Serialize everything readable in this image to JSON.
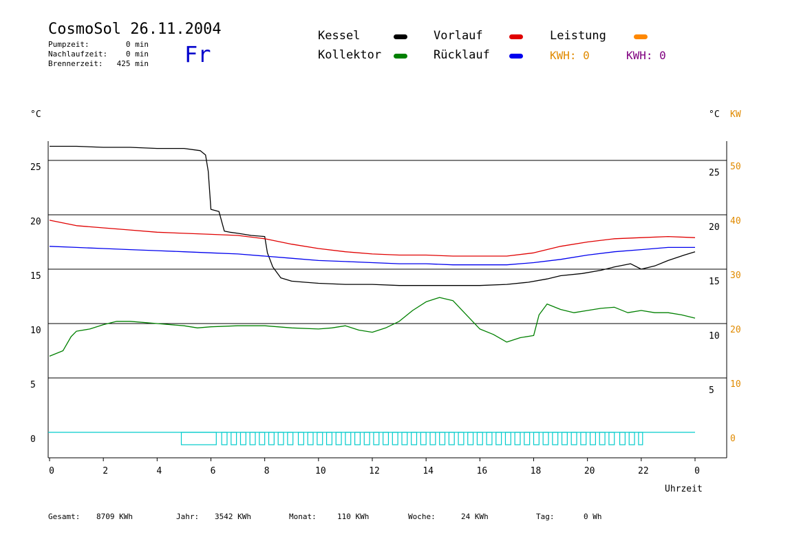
{
  "header": {
    "title": "CosmoSol 26.11.2004",
    "weekday": "Fr",
    "info": [
      {
        "label": "Pumpzeit:",
        "value": "0 min"
      },
      {
        "label": "Nachlaufzeit:",
        "value": "0 min"
      },
      {
        "label": "Brennerzeit:",
        "value": "425 min"
      }
    ]
  },
  "legend": {
    "items": [
      {
        "label": "Kessel",
        "color": "#000000"
      },
      {
        "label": "Kollektor",
        "color": "#008000"
      },
      {
        "label": "Vorlauf",
        "color": "#e00000"
      },
      {
        "label": "Rücklauf",
        "color": "#0000ee"
      },
      {
        "label": "Leistung",
        "color": "#ff8800"
      }
    ],
    "kwh1": "KWH: 0",
    "kwh2": "KWH: 0",
    "kwh1_color": "#e08a00",
    "kwh2_color": "#800080"
  },
  "footer": {
    "gesamt_label": "Gesamt:",
    "gesamt_value": "8709 KWh",
    "jahr_label": "Jahr:",
    "jahr_value": "3542 KWh",
    "monat_label": "Monat:",
    "monat_value": "110 KWh",
    "woche_label": "Woche:",
    "woche_value": "24 KWh",
    "tag_label": "Tag:",
    "tag_value": "0 Wh"
  },
  "chart_data": {
    "type": "line",
    "xlabel": "Uhrzeit",
    "left_unit": "°C",
    "right_unit": "°C",
    "right_unit2": "KW",
    "x_ticks": [
      "0",
      "2",
      "4",
      "6",
      "8",
      "10",
      "12",
      "14",
      "16",
      "18",
      "20",
      "22",
      "0"
    ],
    "y_left_ticks": [
      "0",
      "5",
      "10",
      "15",
      "20",
      "25"
    ],
    "y_right_ticks": [
      "5",
      "10",
      "15",
      "20",
      "25"
    ],
    "y_right2_ticks": [
      "0",
      "10",
      "20",
      "30",
      "40",
      "50"
    ],
    "xlim": [
      0,
      24
    ],
    "ylim": [
      -2,
      27
    ],
    "grid": true,
    "series": [
      {
        "name": "Kessel",
        "color": "#000000",
        "points": [
          [
            0,
            26.3
          ],
          [
            1,
            26.3
          ],
          [
            2,
            26.2
          ],
          [
            3,
            26.2
          ],
          [
            4,
            26.1
          ],
          [
            5,
            26.1
          ],
          [
            5.6,
            25.9
          ],
          [
            5.8,
            25.5
          ],
          [
            5.9,
            24
          ],
          [
            6.0,
            20.5
          ],
          [
            6.3,
            20.3
          ],
          [
            6.5,
            18.5
          ],
          [
            6.7,
            18.4
          ],
          [
            7.0,
            18.3
          ],
          [
            7.5,
            18.1
          ],
          [
            8.0,
            18.0
          ],
          [
            8.1,
            16.5
          ],
          [
            8.3,
            15.2
          ],
          [
            8.6,
            14.2
          ],
          [
            9.0,
            13.9
          ],
          [
            9.5,
            13.8
          ],
          [
            10,
            13.7
          ],
          [
            11,
            13.6
          ],
          [
            12,
            13.6
          ],
          [
            13,
            13.5
          ],
          [
            14,
            13.5
          ],
          [
            15,
            13.5
          ],
          [
            16,
            13.5
          ],
          [
            17,
            13.6
          ],
          [
            17.8,
            13.8
          ],
          [
            18.5,
            14.1
          ],
          [
            19,
            14.4
          ],
          [
            19.8,
            14.6
          ],
          [
            20.5,
            14.9
          ],
          [
            21,
            15.2
          ],
          [
            21.6,
            15.5
          ],
          [
            22,
            15.0
          ],
          [
            22.5,
            15.3
          ],
          [
            23,
            15.8
          ],
          [
            23.6,
            16.3
          ],
          [
            24,
            16.6
          ]
        ]
      },
      {
        "name": "Vorlauf",
        "color": "#e00000",
        "points": [
          [
            0,
            19.5
          ],
          [
            1,
            19.0
          ],
          [
            2,
            18.8
          ],
          [
            3,
            18.6
          ],
          [
            4,
            18.4
          ],
          [
            5,
            18.3
          ],
          [
            6,
            18.2
          ],
          [
            7,
            18.1
          ],
          [
            8,
            17.8
          ],
          [
            9,
            17.3
          ],
          [
            10,
            16.9
          ],
          [
            11,
            16.6
          ],
          [
            12,
            16.4
          ],
          [
            13,
            16.3
          ],
          [
            14,
            16.3
          ],
          [
            15,
            16.2
          ],
          [
            16,
            16.2
          ],
          [
            17,
            16.2
          ],
          [
            18,
            16.5
          ],
          [
            19,
            17.1
          ],
          [
            20,
            17.5
          ],
          [
            21,
            17.8
          ],
          [
            22,
            17.9
          ],
          [
            23,
            18.0
          ],
          [
            24,
            17.9
          ]
        ]
      },
      {
        "name": "Rücklauf",
        "color": "#0000ee",
        "points": [
          [
            0,
            17.1
          ],
          [
            1,
            17.0
          ],
          [
            2,
            16.9
          ],
          [
            3,
            16.8
          ],
          [
            4,
            16.7
          ],
          [
            5,
            16.6
          ],
          [
            6,
            16.5
          ],
          [
            7,
            16.4
          ],
          [
            8,
            16.2
          ],
          [
            9,
            16.0
          ],
          [
            10,
            15.8
          ],
          [
            11,
            15.7
          ],
          [
            12,
            15.6
          ],
          [
            13,
            15.5
          ],
          [
            14,
            15.5
          ],
          [
            15,
            15.4
          ],
          [
            16,
            15.4
          ],
          [
            17,
            15.4
          ],
          [
            18,
            15.6
          ],
          [
            19,
            15.9
          ],
          [
            20,
            16.3
          ],
          [
            21,
            16.6
          ],
          [
            22,
            16.8
          ],
          [
            23,
            17.0
          ],
          [
            24,
            17.0
          ]
        ]
      },
      {
        "name": "Kollektor",
        "color": "#008000",
        "points": [
          [
            0,
            7.0
          ],
          [
            0.5,
            7.5
          ],
          [
            0.8,
            8.8
          ],
          [
            1,
            9.3
          ],
          [
            1.5,
            9.5
          ],
          [
            2,
            9.9
          ],
          [
            2.5,
            10.2
          ],
          [
            3,
            10.2
          ],
          [
            4,
            10.0
          ],
          [
            5,
            9.8
          ],
          [
            5.5,
            9.6
          ],
          [
            6,
            9.7
          ],
          [
            7,
            9.8
          ],
          [
            8,
            9.8
          ],
          [
            9,
            9.6
          ],
          [
            10,
            9.5
          ],
          [
            10.5,
            9.6
          ],
          [
            11,
            9.8
          ],
          [
            11.5,
            9.4
          ],
          [
            12,
            9.2
          ],
          [
            12.5,
            9.6
          ],
          [
            13,
            10.2
          ],
          [
            13.5,
            11.2
          ],
          [
            14,
            12.0
          ],
          [
            14.5,
            12.4
          ],
          [
            15,
            12.1
          ],
          [
            15.5,
            10.8
          ],
          [
            16,
            9.5
          ],
          [
            16.5,
            9.0
          ],
          [
            17,
            8.3
          ],
          [
            17.5,
            8.7
          ],
          [
            18,
            8.9
          ],
          [
            18.2,
            10.8
          ],
          [
            18.5,
            11.8
          ],
          [
            19,
            11.3
          ],
          [
            19.5,
            11.0
          ],
          [
            20,
            11.2
          ],
          [
            20.5,
            11.4
          ],
          [
            21,
            11.5
          ],
          [
            21.5,
            11.0
          ],
          [
            22,
            11.2
          ],
          [
            22.5,
            11.0
          ],
          [
            23,
            11.0
          ],
          [
            23.5,
            10.8
          ],
          [
            24,
            10.5
          ]
        ]
      }
    ],
    "pump_on_intervals": [
      [
        4.9,
        6.2
      ],
      [
        6.4,
        6.6
      ],
      [
        6.75,
        6.95
      ],
      [
        7.1,
        7.3
      ],
      [
        7.45,
        7.65
      ],
      [
        7.8,
        8.0
      ],
      [
        8.15,
        8.35
      ],
      [
        8.5,
        8.7
      ],
      [
        8.85,
        9.05
      ],
      [
        9.25,
        9.45
      ],
      [
        9.6,
        9.8
      ],
      [
        9.95,
        10.15
      ],
      [
        10.3,
        10.5
      ],
      [
        10.65,
        10.85
      ],
      [
        11.0,
        11.2
      ],
      [
        11.35,
        11.55
      ],
      [
        11.7,
        11.9
      ],
      [
        12.05,
        12.25
      ],
      [
        12.4,
        12.6
      ],
      [
        12.75,
        12.95
      ],
      [
        13.1,
        13.3
      ],
      [
        13.45,
        13.65
      ],
      [
        13.8,
        14.0
      ],
      [
        14.15,
        14.35
      ],
      [
        14.5,
        14.7
      ],
      [
        14.85,
        15.05
      ],
      [
        15.2,
        15.4
      ],
      [
        15.55,
        15.75
      ],
      [
        15.9,
        16.1
      ],
      [
        16.25,
        16.45
      ],
      [
        16.6,
        16.8
      ],
      [
        16.95,
        17.15
      ],
      [
        17.3,
        17.5
      ],
      [
        17.65,
        17.85
      ],
      [
        18.0,
        18.2
      ],
      [
        18.35,
        18.55
      ],
      [
        18.7,
        18.9
      ],
      [
        19.05,
        19.25
      ],
      [
        19.4,
        19.6
      ],
      [
        19.75,
        19.95
      ],
      [
        20.1,
        20.3
      ],
      [
        20.45,
        20.65
      ],
      [
        20.8,
        21.0
      ],
      [
        21.2,
        21.4
      ],
      [
        21.55,
        21.75
      ],
      [
        21.9,
        22.05
      ]
    ]
  }
}
